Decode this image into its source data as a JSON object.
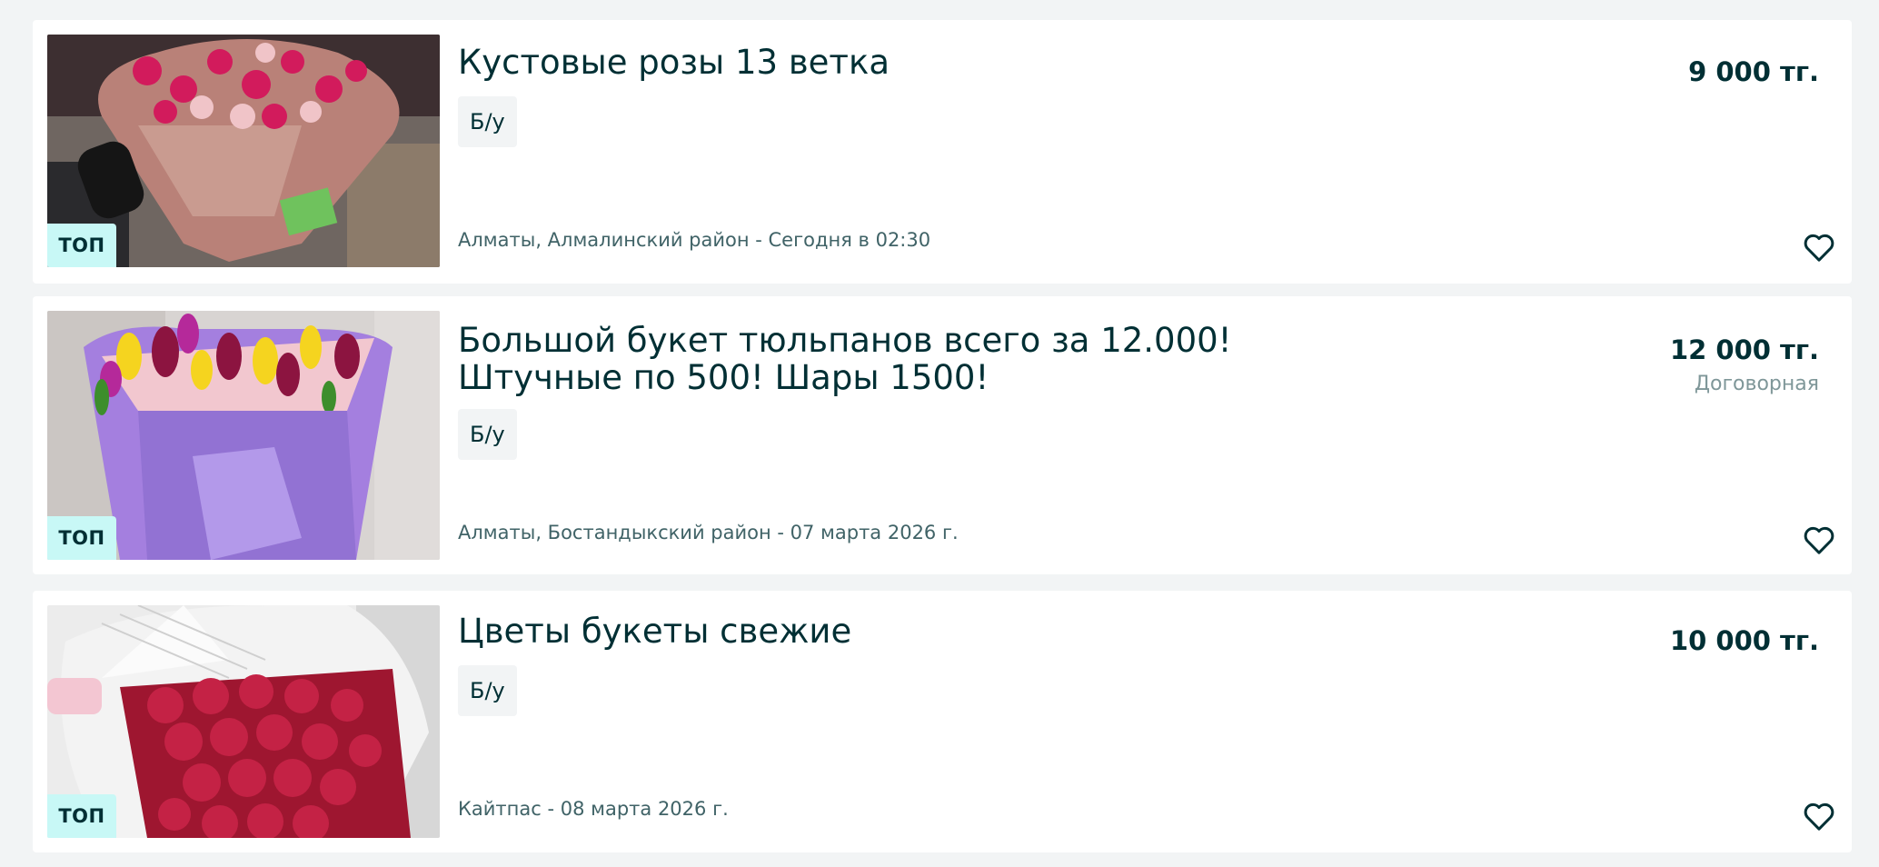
{
  "listings": [
    {
      "title_lines": [
        "Кустовые розы 13 ветка"
      ],
      "condition": "Б/у",
      "location": "Алматы, Алмалинский район - Сегодня в 02:30",
      "price": "9 000 тг.",
      "negotiable": "",
      "badge": "ТОП",
      "image": "bouquet-spray-roses-photo",
      "favorite_icon": "heart-outline-icon"
    },
    {
      "title_lines": [
        "Большой букет тюльпанов всего за 12.000!",
        "Штучные по 500! Шары 1500!"
      ],
      "condition": "Б/у",
      "location": "Алматы, Бостандыкский район - 07 марта 2026 г.",
      "price": "12 000 тг.",
      "negotiable": "Договорная",
      "badge": "ТОП",
      "image": "tulip-bouquet-purple-wrap-photo",
      "favorite_icon": "heart-outline-icon"
    },
    {
      "title_lines": [
        "Цветы букеты свежие"
      ],
      "condition": "Б/у",
      "location": "Кайтпас - 08 марта 2026 г.",
      "price": "10 000 тг.",
      "negotiable": "",
      "badge": "ТОП",
      "image": "red-roses-white-wrap-photo",
      "favorite_icon": "heart-outline-icon"
    }
  ],
  "colors": {
    "page_background": "#f2f4f5",
    "card_background": "#ffffff",
    "text_primary": "#002f34",
    "text_secondary": "#406367",
    "badge_top": "#c8f8f6"
  }
}
